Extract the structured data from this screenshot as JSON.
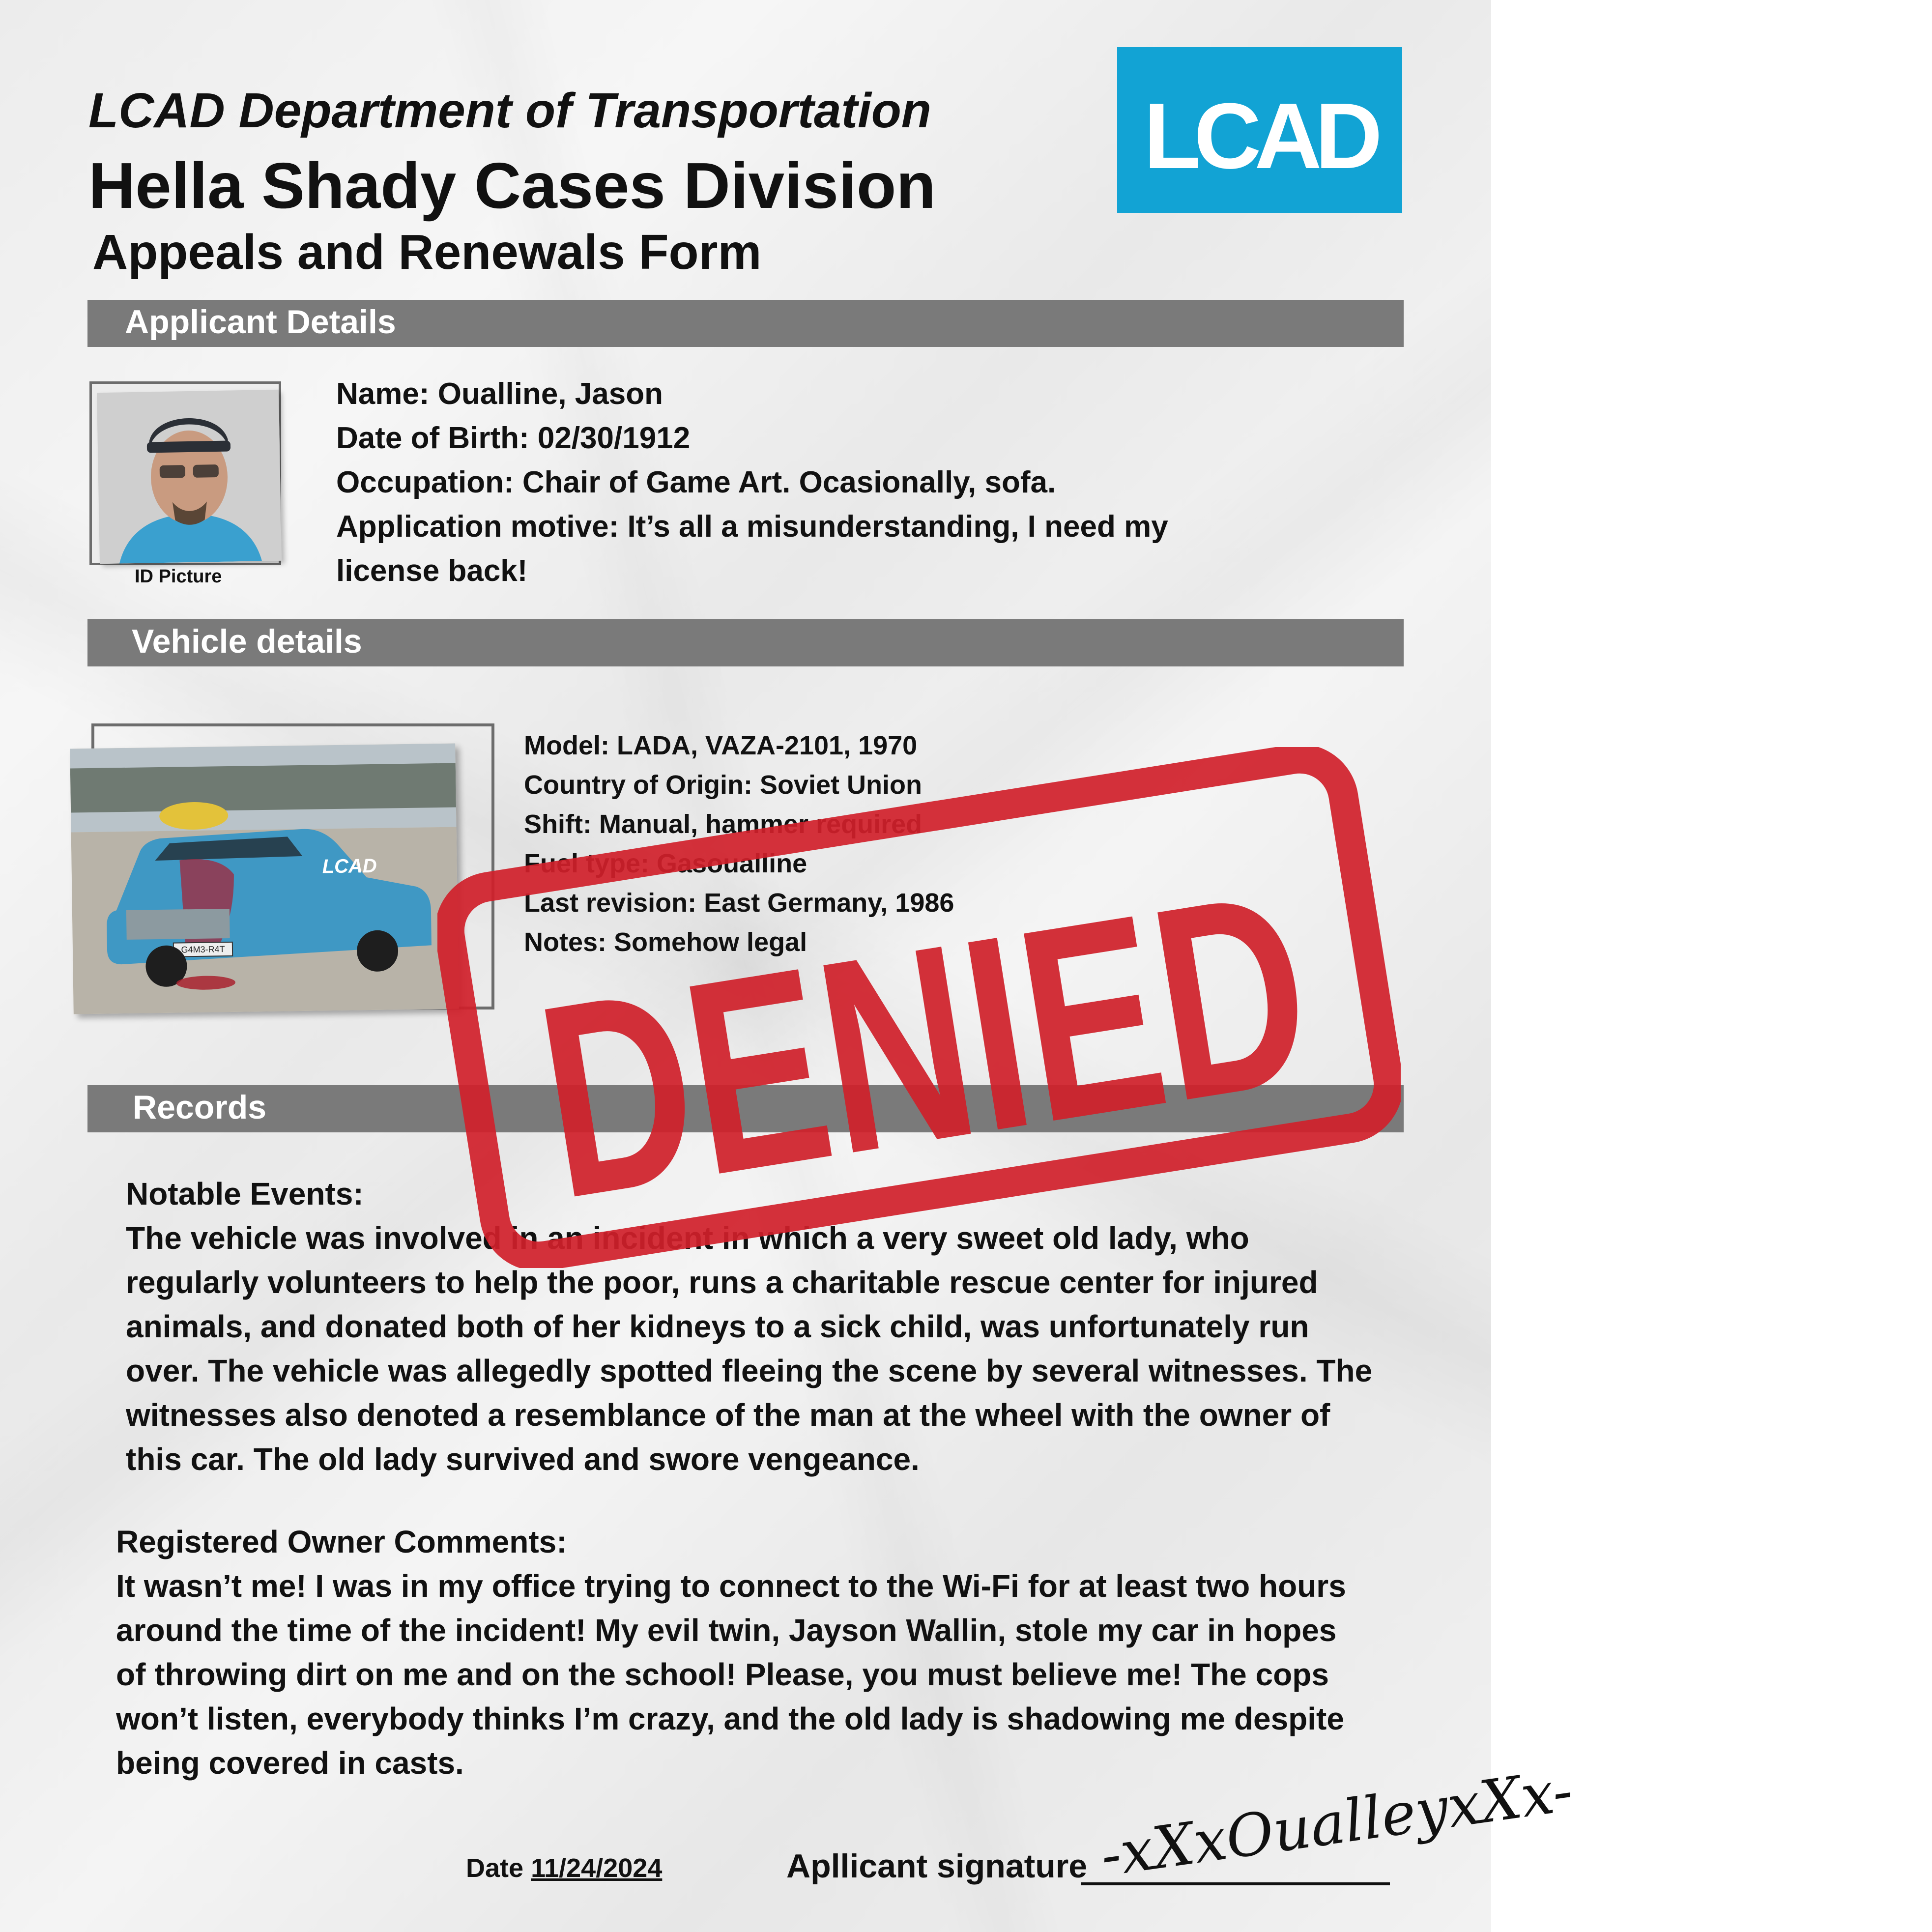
{
  "header": {
    "department": "LCAD Department of Transportation",
    "division": "Hella Shady Cases Division",
    "form_title": "Appeals and Renewals Form",
    "logo_text": "LCAD",
    "logo_color": "#12a3d4"
  },
  "sections": {
    "applicant": "Applicant Details",
    "vehicle": "Vehicle details",
    "records": "Records"
  },
  "applicant": {
    "id_picture_label": "ID Picture",
    "name": "Name: Oualline, Jason",
    "dob": "Date of Birth: 02/30/1912",
    "occupation": "Occupation: Chair of Game Art. Ocasionally, sofa.",
    "motive_line1": "Application motive: It’s all a misunderstanding, I need my",
    "motive_line2": "license back!"
  },
  "vehicle": {
    "model": "Model: LADA, VAZA-2101, 1970",
    "origin": "Country of Origin: Soviet Union",
    "shift": "Shift: Manual, hammer required",
    "fuel": "Fuel type: Gasoualline",
    "revision": "Last revision: East Germany, 1986",
    "notes": "Notes: Somehow legal",
    "door_logo": "LCAD",
    "plate": "G4M3-R4T"
  },
  "records": {
    "events_title": "Notable Events:",
    "events_lines": [
      "The vehicle was involved in an incident in which a very sweet old lady, who",
      "regularly volunteers to help the poor, runs a charitable rescue center for injured",
      "animals, and donated both of her kidneys to a sick child, was unfortunately run",
      "over. The vehicle was allegedly spotted fleeing the scene by several witnesses. The",
      "witnesses also denoted a resemblance of the man at the wheel with the owner of",
      "this car. The old lady survived and swore vengeance."
    ],
    "comments_title": "Registered Owner Comments:",
    "comments_lines": [
      "It wasn’t me! I was in my office trying to connect to the Wi-Fi for at least two hours",
      "around the time of the incident! My evil twin, Jayson Wallin, stole my car in hopes",
      "of throwing dirt on me and on the school! Please, you must believe me! The cops",
      "won’t listen, everybody thinks I’m crazy, and the old lady is shadowing me despite",
      "being covered in casts."
    ]
  },
  "footer": {
    "date_label": "Date",
    "date_value": "11/24/2024",
    "signature_label": "Apllicant signature",
    "signature_text": "-xXxOualleyxXx-"
  },
  "stamp": {
    "text": "DENIED",
    "color": "#d0202a"
  }
}
